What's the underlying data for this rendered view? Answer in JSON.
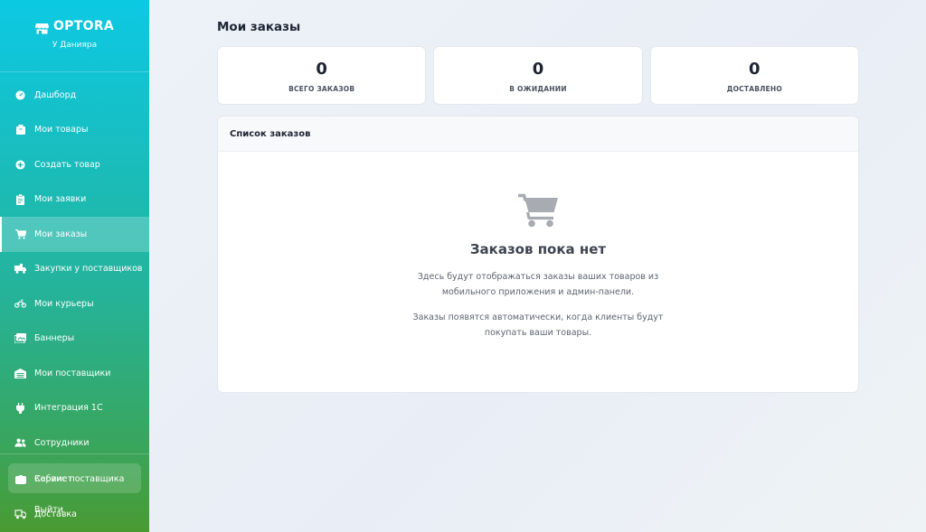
{
  "sidebar": {
    "brand": "OPTORA",
    "subtitle": "У Данияра",
    "items": [
      {
        "label": "Дашборд",
        "icon": "dashboard-icon"
      },
      {
        "label": "Мои товары",
        "icon": "box-icon"
      },
      {
        "label": "Создать товар",
        "icon": "plus-circle-icon"
      },
      {
        "label": "Мои заявки",
        "icon": "clipboard-icon"
      },
      {
        "label": "Мои заказы",
        "icon": "cart-icon",
        "active": true
      },
      {
        "label": "Закупки у поставщиков",
        "icon": "truck-loading-icon"
      },
      {
        "label": "Мои курьеры",
        "icon": "motorcycle-icon"
      },
      {
        "label": "Баннеры",
        "icon": "images-icon"
      },
      {
        "label": "Мои поставщики",
        "icon": "warehouse-icon"
      },
      {
        "label": "Интеграция 1С",
        "icon": "plug-icon"
      },
      {
        "label": "Сотрудники",
        "icon": "users-icon"
      }
    ],
    "overlap": {
      "profile_label": "Кабинет",
      "supplier_label": "Сервис поставщика",
      "logout_label": "Выйти",
      "delivery_label": "Доставка"
    }
  },
  "main": {
    "title": "Мои заказы",
    "stats": [
      {
        "value": "0",
        "label": "ВСЕГО ЗАКАЗОВ"
      },
      {
        "value": "0",
        "label": "В ОЖИДАНИИ"
      },
      {
        "value": "0",
        "label": "ДОСТАВЛЕНО"
      }
    ],
    "orders": {
      "header": "Список заказов",
      "empty_title": "Заказов пока нет",
      "empty_text_1": "Здесь будут отображаться заказы ваших товаров из мобильного приложения и админ-панели.",
      "empty_text_2": "Заказы появятся автоматически, когда клиенты будут покупать ваши товары."
    }
  },
  "colors": {
    "sidebar_top": "#0cc9e3",
    "sidebar_bottom": "#4a9a32",
    "empty_cart": "#a8abb2"
  }
}
